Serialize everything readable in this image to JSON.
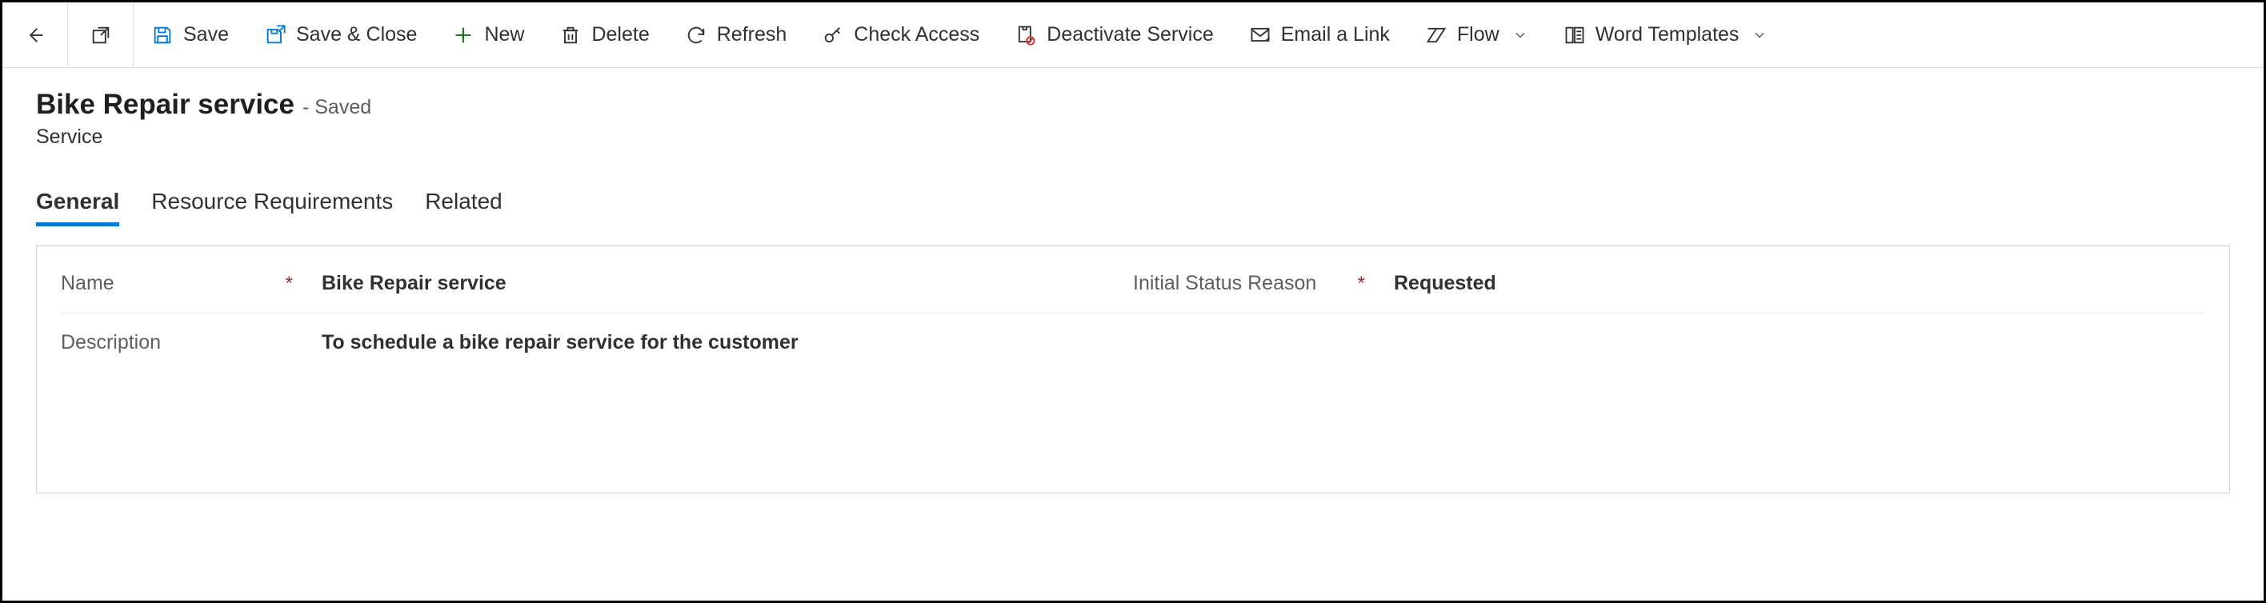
{
  "commandBar": {
    "save": "Save",
    "saveClose": "Save & Close",
    "new": "New",
    "delete": "Delete",
    "refresh": "Refresh",
    "checkAccess": "Check Access",
    "deactivate": "Deactivate Service",
    "emailLink": "Email a Link",
    "flow": "Flow",
    "wordTemplates": "Word Templates"
  },
  "header": {
    "title": "Bike Repair service",
    "statusSuffix": "- Saved",
    "entityType": "Service"
  },
  "tabs": {
    "general": "General",
    "resourceRequirements": "Resource Requirements",
    "related": "Related"
  },
  "form": {
    "nameLabel": "Name",
    "nameValue": "Bike Repair service",
    "initialStatusLabel": "Initial Status Reason",
    "initialStatusValue": "Requested",
    "descriptionLabel": "Description",
    "descriptionValue": "To schedule a bike repair service for the customer"
  }
}
